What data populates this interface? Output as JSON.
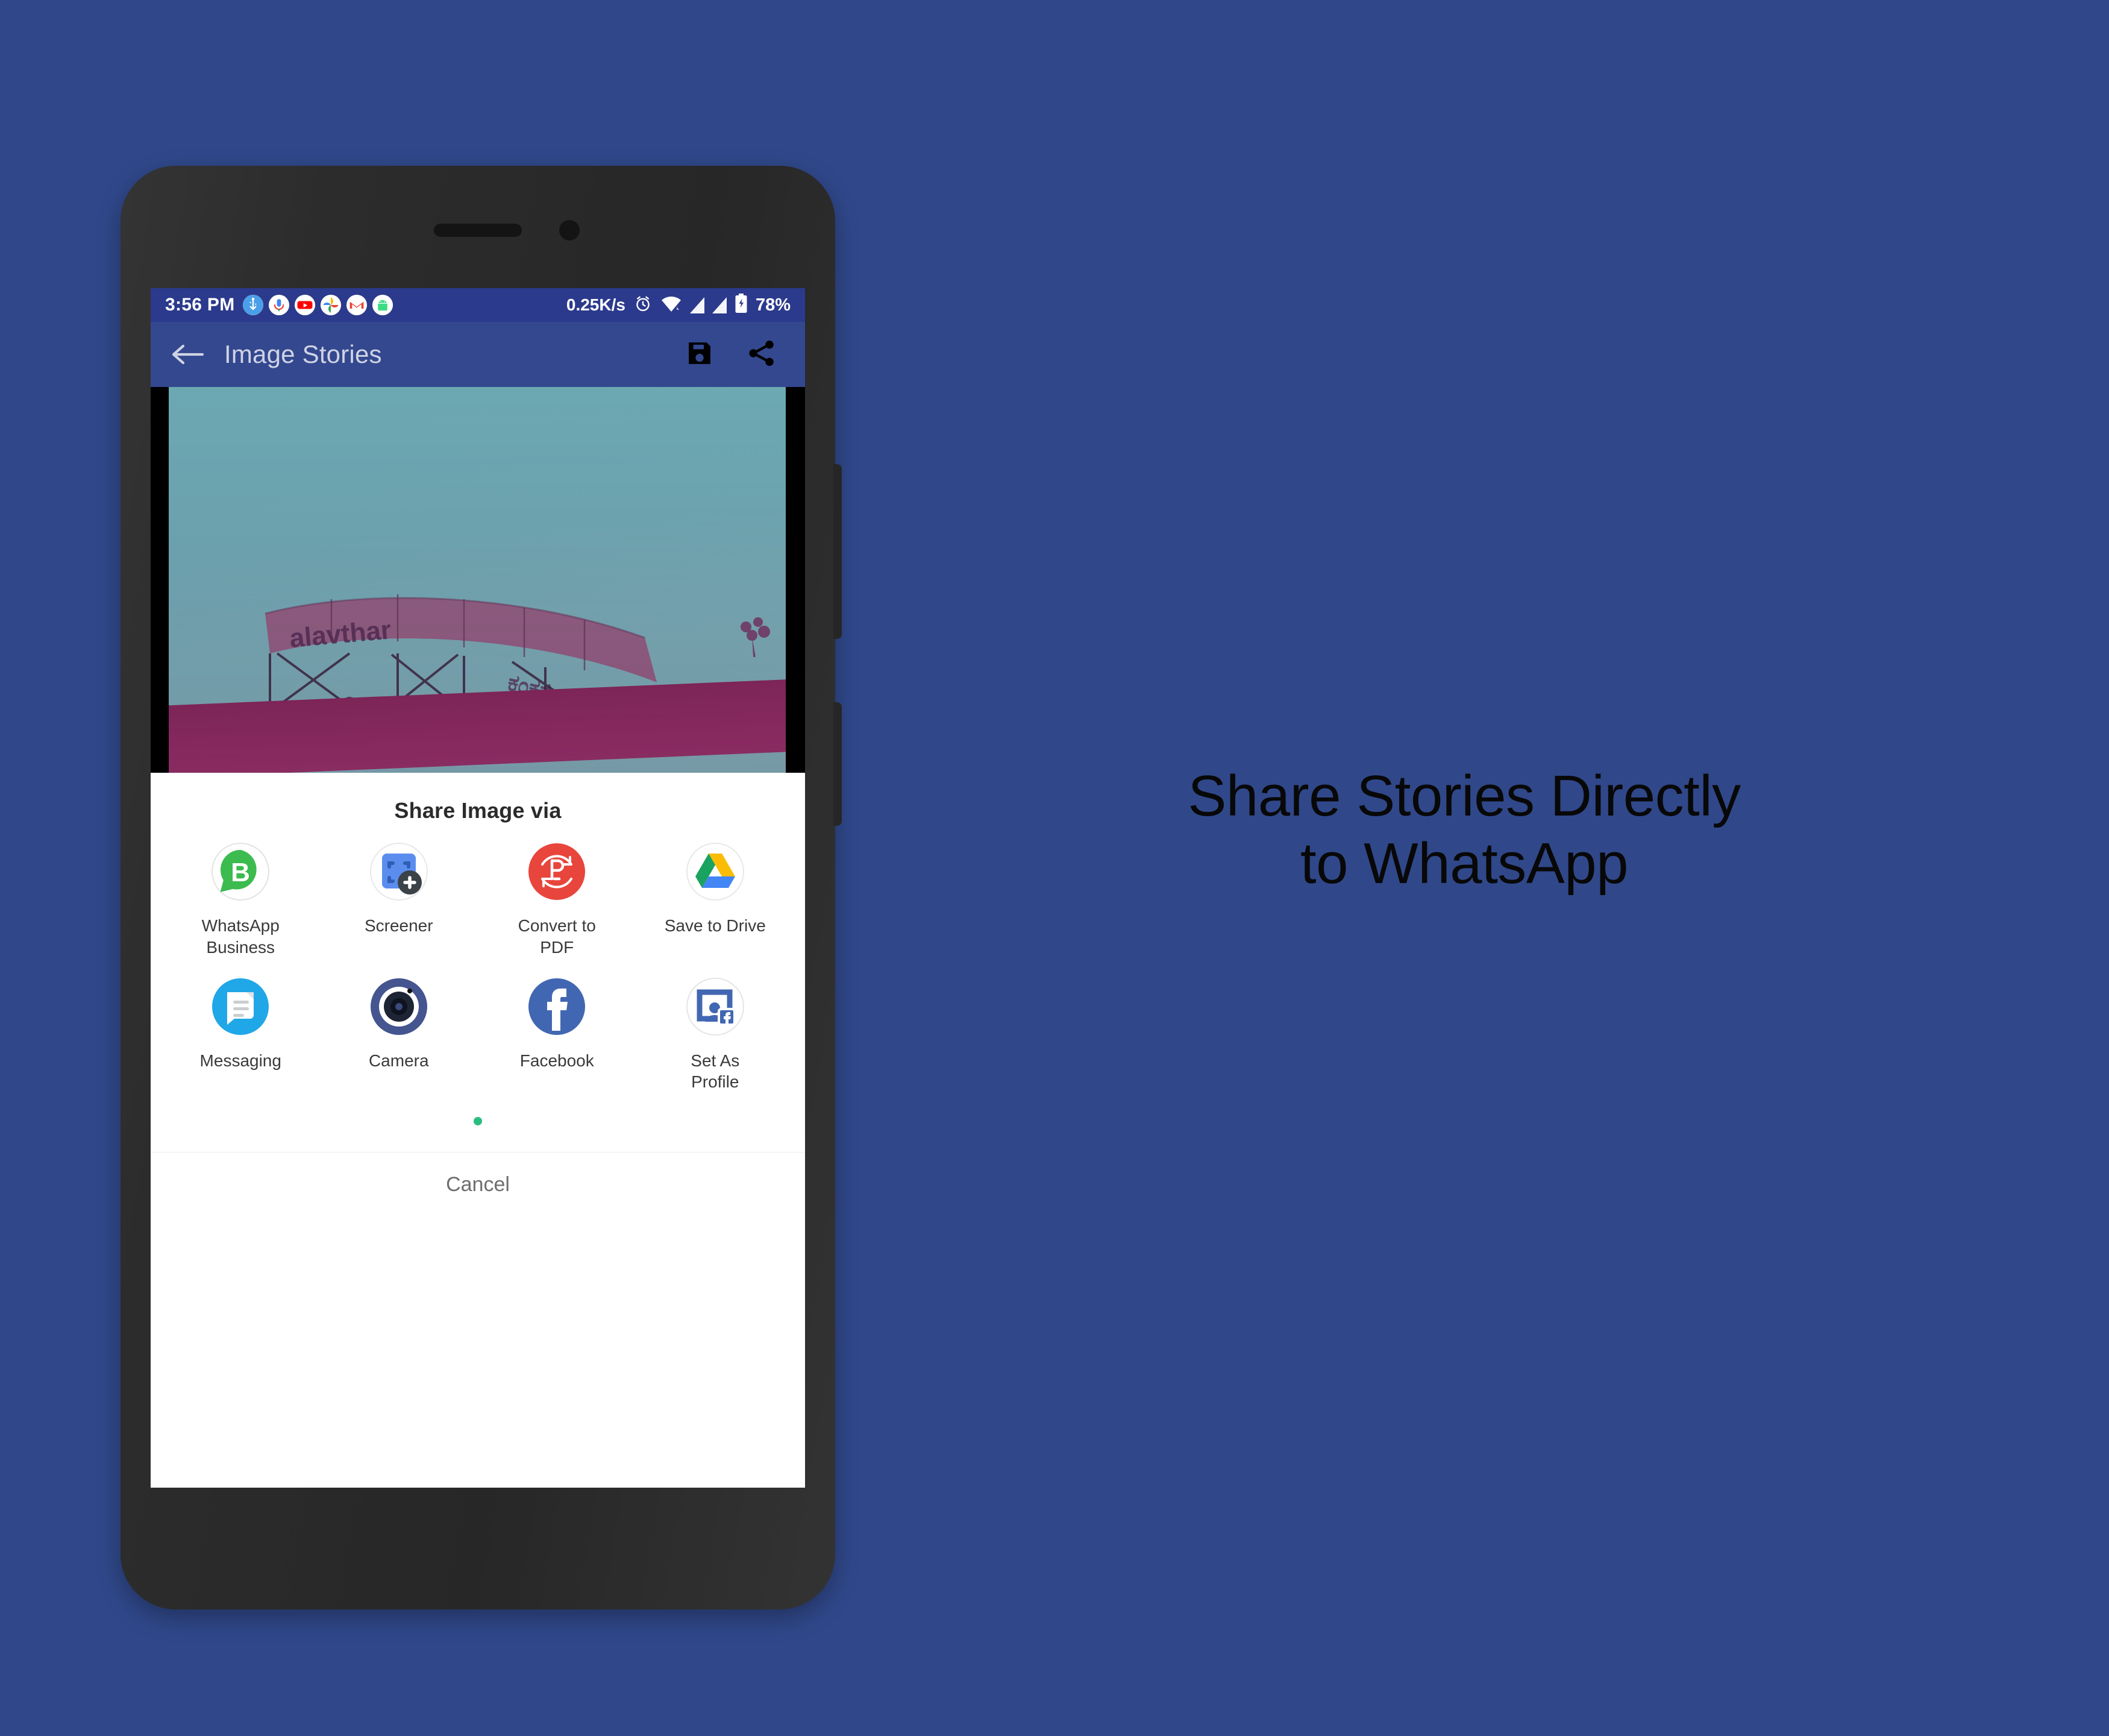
{
  "canvas": {
    "background_color": "#30488a"
  },
  "phone": {
    "status_bar": {
      "time": "3:56 PM",
      "background_color": "#2b3a8c",
      "left_icons": [
        {
          "name": "usb-icon",
          "glyph": "↓"
        },
        {
          "name": "google-assistant-mic-icon",
          "glyph": "•"
        },
        {
          "name": "youtube-icon",
          "glyph": "▶"
        },
        {
          "name": "google-photos-icon",
          "glyph": "✸"
        },
        {
          "name": "gmail-icon",
          "glyph": "M"
        },
        {
          "name": "android-icon",
          "glyph": "▲"
        }
      ],
      "network_speed": "0.25K/s",
      "alarm_icon": "alarm-icon",
      "wifi_icon": "wifi-icon",
      "signal_icons": [
        "signal-bars-sim1-icon",
        "signal-bars-sim2-icon"
      ],
      "battery_icon": "battery-charging-icon",
      "battery_percent": "78%"
    },
    "app_bar": {
      "background_color": "#34488f",
      "back_icon": "back-arrow-icon",
      "title": "Image Stories",
      "save_icon": "save-floppy-icon",
      "share_icon": "share-nodes-icon"
    },
    "photo_preview": {
      "description": "Duotone teal and magenta photo of an arched signboard on a rooftop",
      "sign_text": "alavthar",
      "sky_color": "#7ab6bc",
      "ground_color": "#93306a"
    },
    "share_sheet": {
      "title": "Share Image via",
      "rows": [
        [
          {
            "label": "WhatsApp\nBusiness",
            "icon": "whatsapp-business-icon",
            "accent": "#3cbb4e"
          },
          {
            "label": "Screener",
            "icon": "screener-icon",
            "accent": "#5b8def"
          },
          {
            "label": "Convert to\nPDF",
            "icon": "convert-to-pdf-icon",
            "accent": "#e8453c"
          },
          {
            "label": "Save to Drive",
            "icon": "google-drive-icon",
            "accent": "#fbbc05"
          }
        ],
        [
          {
            "label": "Messaging",
            "icon": "messaging-icon",
            "accent": "#20a7e8"
          },
          {
            "label": "Camera",
            "icon": "camera-icon",
            "accent": "#44558f"
          },
          {
            "label": "Facebook",
            "icon": "facebook-icon",
            "accent": "#4267b2"
          },
          {
            "label": "Set As\nProfile",
            "icon": "set-as-profile-icon",
            "accent": "#4267b2"
          }
        ]
      ],
      "page_indicator_color": "#2bbd7e",
      "cancel_label": "Cancel"
    }
  },
  "marketing": {
    "line1": "Share Stories Directly",
    "line2": "to WhatsApp"
  }
}
